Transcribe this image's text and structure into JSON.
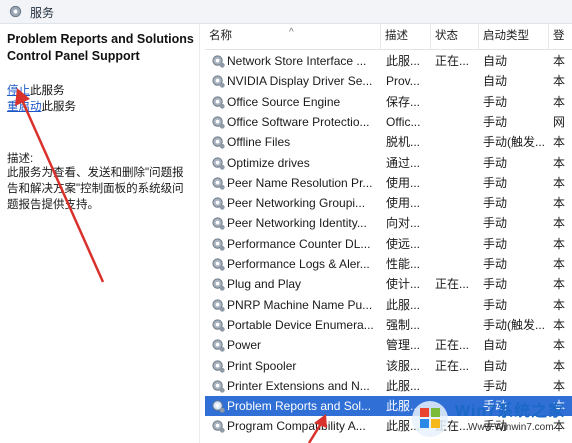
{
  "window": {
    "title": "服务"
  },
  "left_pane": {
    "service_title": "Problem Reports and Solutions Control Panel Support",
    "stop_link": "停止",
    "stop_rest": "此服务",
    "restart_link": "重启动",
    "restart_rest": "此服务",
    "description_label": "描述:",
    "description_text": "此服务为查看、发送和删除\"问题报告和解决方案\"控制面板的系统级问题报告提供支持。"
  },
  "table": {
    "headers": {
      "name": "名称",
      "description": "描述",
      "status": "状态",
      "startup": "启动类型",
      "logon": "登"
    },
    "rows": [
      {
        "name": "Network Store Interface ...",
        "desc": "此服...",
        "status": "正在...",
        "startup": "自动",
        "logon": "本"
      },
      {
        "name": "NVIDIA Display Driver Se...",
        "desc": "Prov...",
        "status": "",
        "startup": "自动",
        "logon": "本"
      },
      {
        "name": "Office  Source Engine",
        "desc": "保存...",
        "status": "",
        "startup": "手动",
        "logon": "本"
      },
      {
        "name": "Office Software Protectio...",
        "desc": "Offic...",
        "status": "",
        "startup": "手动",
        "logon": "网"
      },
      {
        "name": "Offline Files",
        "desc": "脱机...",
        "status": "",
        "startup": "手动(触发...",
        "logon": "本"
      },
      {
        "name": "Optimize drives",
        "desc": "通过...",
        "status": "",
        "startup": "手动",
        "logon": "本"
      },
      {
        "name": "Peer Name Resolution Pr...",
        "desc": "使用...",
        "status": "",
        "startup": "手动",
        "logon": "本"
      },
      {
        "name": "Peer Networking Groupi...",
        "desc": "使用...",
        "status": "",
        "startup": "手动",
        "logon": "本"
      },
      {
        "name": "Peer Networking Identity...",
        "desc": "向对...",
        "status": "",
        "startup": "手动",
        "logon": "本"
      },
      {
        "name": "Performance Counter DL...",
        "desc": "使远...",
        "status": "",
        "startup": "手动",
        "logon": "本"
      },
      {
        "name": "Performance Logs & Aler...",
        "desc": "性能...",
        "status": "",
        "startup": "手动",
        "logon": "本"
      },
      {
        "name": "Plug and Play",
        "desc": "使计...",
        "status": "正在...",
        "startup": "手动",
        "logon": "本"
      },
      {
        "name": "PNRP Machine Name Pu...",
        "desc": "此服...",
        "status": "",
        "startup": "手动",
        "logon": "本"
      },
      {
        "name": "Portable Device Enumera...",
        "desc": "强制...",
        "status": "",
        "startup": "手动(触发...",
        "logon": "本"
      },
      {
        "name": "Power",
        "desc": "管理...",
        "status": "正在...",
        "startup": "自动",
        "logon": "本"
      },
      {
        "name": "Print Spooler",
        "desc": "该服...",
        "status": "正在...",
        "startup": "自动",
        "logon": "本"
      },
      {
        "name": "Printer Extensions and N...",
        "desc": "此服...",
        "status": "",
        "startup": "手动",
        "logon": "本"
      },
      {
        "name": "Problem Reports and Sol...",
        "desc": "此服...",
        "status": "",
        "startup": "手动",
        "logon": "本",
        "selected": true
      },
      {
        "name": "Program Compatibility A...",
        "desc": "此服...",
        "status": "正在...",
        "startup": "手动",
        "logon": "本"
      }
    ]
  },
  "watermark": {
    "brand": "Win7系统之家",
    "url": "Www.Winwin7.com"
  },
  "colors": {
    "selected_row": "#2f6fd6",
    "link": "#1a56c7",
    "annotation_arrow": "#d9312b"
  }
}
